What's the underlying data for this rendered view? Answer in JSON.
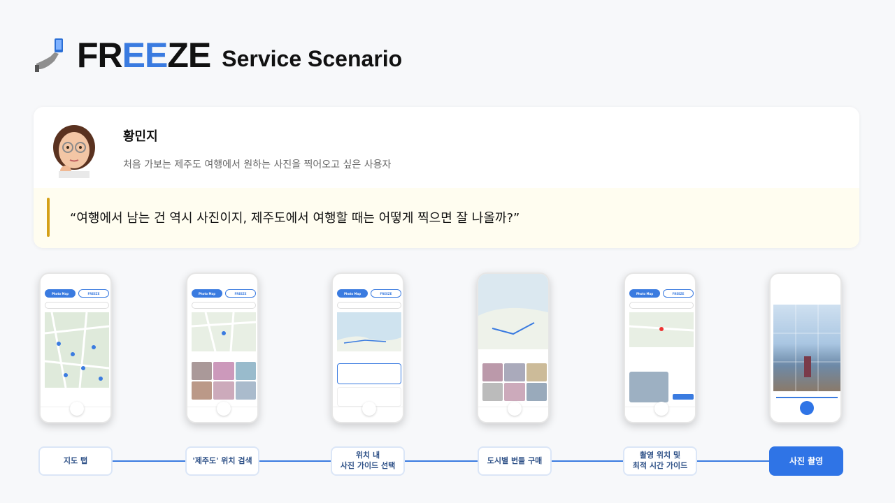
{
  "header": {
    "brand_left": "FR",
    "brand_mid": "EE",
    "brand_right": "ZE",
    "subtitle": "Service Scenario"
  },
  "persona": {
    "name": "황민지",
    "description": "처음 가보는 제주도 여행에서 원하는 사진을 찍어오고 싶은 사용자",
    "quote": "“여행에서 남는 건 역시 사진이지, 제주도에서 여행할 때는 어떻게 찍으면 잘 나올까?”"
  },
  "phone_ui": {
    "tab_photo_map": "Photo Map",
    "tab_freeze": "FREEZE"
  },
  "steps": [
    {
      "label": "지도 탭"
    },
    {
      "label": "'제주도' 위치 검색"
    },
    {
      "label": "위치 내\n사진 가이드 선택"
    },
    {
      "label": "도시별 번들 구매"
    },
    {
      "label": "촬영 위치 및\n최적 시간 가이드"
    },
    {
      "label": "사진 촬영"
    }
  ],
  "colors": {
    "accent": "#3a7be0",
    "quote_bar": "#d4a017",
    "active_step": "#2f74e6"
  }
}
